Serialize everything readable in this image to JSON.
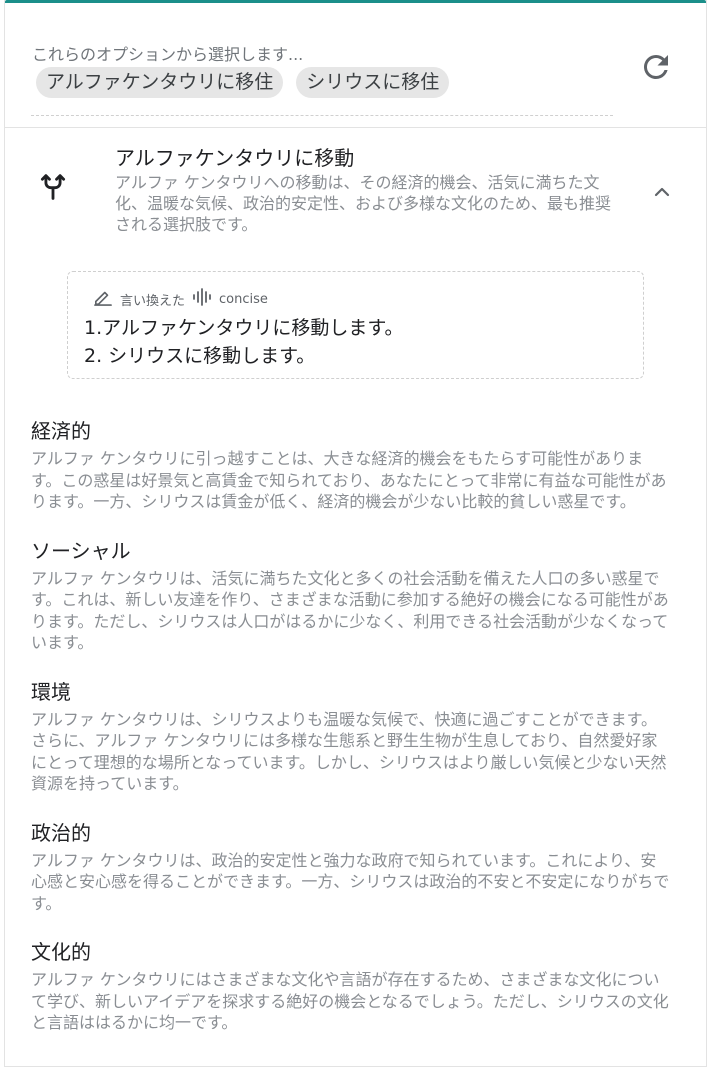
{
  "options": {
    "hint": "これらのオプションから選択します...",
    "chips": [
      "アルファケンタウリに移住",
      "シリウスに移住"
    ],
    "refresh_icon": "refresh-icon"
  },
  "suggestion": {
    "title": "アルファケンタウリに移動",
    "description": "アルファ ケンタウリへの移動は、その経済的機会、活気に満ちた文化、温暖な気候、政治的安定性、および多様な文化のため、最も推奨される選択肢です。",
    "icon": "fork-arrows-icon",
    "collapse_icon": "chevron-up-icon"
  },
  "rephrase": {
    "label": "言い換えた",
    "mode": "concise",
    "lines": [
      "1.アルファケンタウリに移動します。",
      "2. シリウスに移動します。"
    ]
  },
  "sections": [
    {
      "heading": "経済的",
      "body": "アルファ ケンタウリに引っ越すことは、大きな経済的機会をもたらす可能性があります。この惑星は好景気と高賃金で知られており、あなたにとって非常に有益な可能性があります。一方、シリウスは賃金が低く、経済的機会が少ない比較的貧しい惑星です。"
    },
    {
      "heading": "ソーシャル",
      "body": "アルファ ケンタウリは、活気に満ちた文化と多くの社会活動を備えた人口の多い惑星です。これは、新しい友達を作り、さまざまな活動に参加する絶好の機会になる可能性があります。ただし、シリウスは人口がはるかに少なく、利用できる社会活動が少なくなっています。"
    },
    {
      "heading": "環境",
      "body": "アルファ ケンタウリは、シリウスよりも温暖な気候で、快適に過ごすことができます。さらに、アルファ ケンタウリには多様な生態系と野生生物が生息しており、自然愛好家にとって理想的な場所となっています。しかし、シリウスはより厳しい気候と少ない天然資源を持っています。"
    },
    {
      "heading": "政治的",
      "body": "アルファ ケンタウリは、政治的安定性と強力な政府で知られています。これにより、安心感と安心感を得ることができます。一方、シリウスは政治的不安と不安定になりがちです。"
    },
    {
      "heading": "文化的",
      "body": "アルファ ケンタウリにはさまざまな文化や言語が存在するため、さまざまな文化について学び、新しいアイデアを探求する絶好の機会となるでしょう。ただし、シリウスの文化と言語ははるかに均一です。"
    }
  ],
  "colors": {
    "accent": "#1b8f8a",
    "chip_bg": "#e6e6e6",
    "muted_text": "#8a8e93"
  }
}
